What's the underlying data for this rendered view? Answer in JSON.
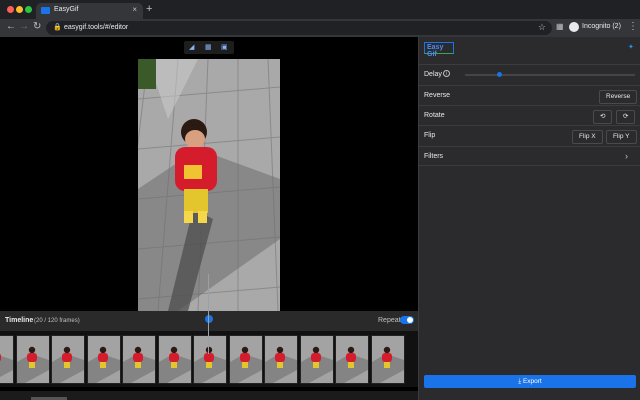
{
  "browser": {
    "tab_title": "EasyGif",
    "tab_close": "×",
    "new_tab": "+",
    "url": "easygif.tools/#/editor",
    "profile_label": "Incognito (2)"
  },
  "editor": {
    "timeline_title": "Timeline",
    "timeline_frames": "(20 / 120 frames)",
    "repeat_label": "Repeat",
    "repeat_on": true,
    "current_frame": 20,
    "total_frames": 120
  },
  "panel": {
    "logo_text": "Easy Gif",
    "delay_label": "Delay",
    "delay_info_icon": "i",
    "delay_slider_level": 0.19,
    "reverse_label": "Reverse",
    "reverse_button": "Reverse",
    "rotate_label": "Rotate",
    "flip_label": "Flip",
    "flip_x_button": "Flip X",
    "flip_y_button": "Flip Y",
    "filters_label": "Filters",
    "export_button": "Export"
  },
  "icons": {
    "tab_favicon": "gif-icon",
    "back": "arrow-left-icon",
    "forward": "arrow-right-icon",
    "reload": "reload-icon",
    "lock": "lock-icon",
    "bookmark": "star-icon",
    "extensions": "puzzle-icon",
    "incognito": "incognito-icon",
    "menu": "kebab-menu-icon",
    "twitter": "twitter-icon",
    "rotate_left": "rotate-left-icon",
    "rotate_right": "rotate-right-icon",
    "filters_chevron": "chevron-right-icon",
    "export": "download-icon",
    "play": "play-icon"
  },
  "colors": {
    "accent": "#1a73e8",
    "panel_bg": "#2b2b2d",
    "editor_bg": "#000000",
    "chrome_bg": "#202124"
  }
}
